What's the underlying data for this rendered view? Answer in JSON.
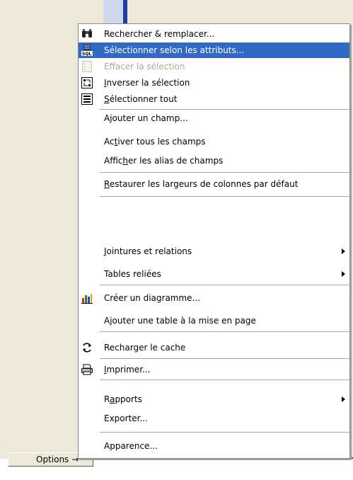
{
  "options_button": {
    "label": "Options",
    "arrow": "→"
  },
  "menu": {
    "items": [
      {
        "label": "Rechercher & remplacer...",
        "underline": -1,
        "icon": "binoculars-icon"
      },
      {
        "label": "Sélectionner selon les attributs...",
        "underline": -1,
        "icon": "sql-select-icon",
        "selected": true
      },
      {
        "label": "Effacer la sélection",
        "underline": -1,
        "icon": "clear-selection-icon",
        "disabled": true
      },
      {
        "label": "Inverser la sélection",
        "underline": 0,
        "icon": "switch-selection-icon"
      },
      {
        "label": "Sélectionner tout",
        "underline": 0,
        "icon": "select-all-icon"
      },
      {
        "label": "Ajouter un champ...",
        "underline": -1
      },
      {
        "label": "Activer tous les champs",
        "underline": 2
      },
      {
        "label": "Afficher les alias de champs",
        "underline": 5
      },
      {
        "label": "Restaurer les largeurs de colonnes par défaut",
        "underline": 0
      },
      {
        "label": "Jointures et relations",
        "underline": 0,
        "submenu": true
      },
      {
        "label": "Tables reliées",
        "underline": -1,
        "submenu": true
      },
      {
        "label": "Créer un diagramme...",
        "underline": -1,
        "icon": "chart-icon"
      },
      {
        "label": "Ajouter une table à la mise en page",
        "underline": -1
      },
      {
        "label": "Recharger le cache",
        "underline": -1,
        "icon": "refresh-icon"
      },
      {
        "label": "Imprimer...",
        "underline": 0,
        "icon": "printer-icon"
      },
      {
        "label": "Rapports",
        "underline": 1,
        "submenu": true
      },
      {
        "label": "Exporter...",
        "underline": -1
      },
      {
        "label": "Apparence...",
        "underline": -1
      }
    ]
  },
  "colors": {
    "highlight": "#316ac5",
    "disabled": "#aca899",
    "accent": "#1c3fa8"
  }
}
